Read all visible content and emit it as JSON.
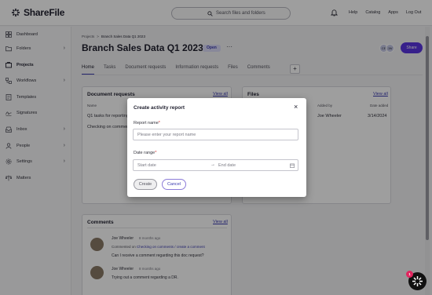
{
  "brand": {
    "name": "ShareFile"
  },
  "search": {
    "placeholder": "Search files and folders"
  },
  "toplinks": [
    "Help",
    "Catalog",
    "Apps",
    "Log Out"
  ],
  "sidebar": {
    "items": [
      {
        "label": "Dashboard",
        "icon": "dashboard-icon"
      },
      {
        "label": "Folders",
        "icon": "folder-icon"
      },
      {
        "label": "Projects",
        "icon": "projects-icon",
        "active": true
      },
      {
        "label": "Workflows",
        "icon": "workflow-icon"
      },
      {
        "label": "Templates",
        "icon": "template-icon"
      },
      {
        "label": "Signatures",
        "icon": "signature-icon"
      },
      {
        "label": "Inbox",
        "icon": "inbox-icon"
      },
      {
        "label": "People",
        "icon": "people-icon"
      },
      {
        "label": "Settings",
        "icon": "gear-icon"
      },
      {
        "label": "Matters",
        "icon": "matters-icon"
      }
    ]
  },
  "breadcrumb": {
    "root": "Projects",
    "sep": ">",
    "current": "Branch Sales Data Q1 2023"
  },
  "project": {
    "title": "Branch Sales Data Q1 2023",
    "status": "Open",
    "more": "···"
  },
  "avatars": [
    "CE",
    "JW"
  ],
  "share_label": "Share",
  "tabs": [
    "Home",
    "Tasks",
    "Document requests",
    "Information requests",
    "Files",
    "Comments"
  ],
  "add_tab": "+",
  "doc_requests": {
    "title": "Document requests",
    "view_all": "View all",
    "col_name": "Name",
    "rows": [
      "Q1 tasks for reporting",
      "Checking on comments"
    ]
  },
  "files": {
    "title": "Files",
    "view_all": "View all",
    "col_added_by": "Added by",
    "col_date": "Date added",
    "rows": [
      {
        "added_by": "Joe Wheeler",
        "date": "3/14/2024"
      }
    ]
  },
  "comments": {
    "title": "Comments",
    "view_all": "View all",
    "items": [
      {
        "author": "Joe Wheeler",
        "time": "8 months ago",
        "context_prefix": "Commented on",
        "context_link": "Checking on comments / create a comment",
        "text": "Can I receive a comment regarding this doc request?"
      },
      {
        "author": "Joe Wheeler",
        "time": "8 months ago",
        "text": "Trying out a comment regarding a DR."
      }
    ]
  },
  "modal": {
    "title": "Create activity report",
    "report_name_label": "Report name",
    "report_name_placeholder": "Please enter your report name",
    "date_range_label": "Date range",
    "start_placeholder": "Start date",
    "arrow": "→",
    "end_placeholder": "End date",
    "required_mark": "*",
    "create_label": "Create",
    "cancel_label": "Cancel"
  },
  "chat": {
    "badge": "1"
  },
  "colors": {
    "accent": "#5a35e0",
    "link": "#3a3ab0",
    "badge": "#e0245e"
  }
}
